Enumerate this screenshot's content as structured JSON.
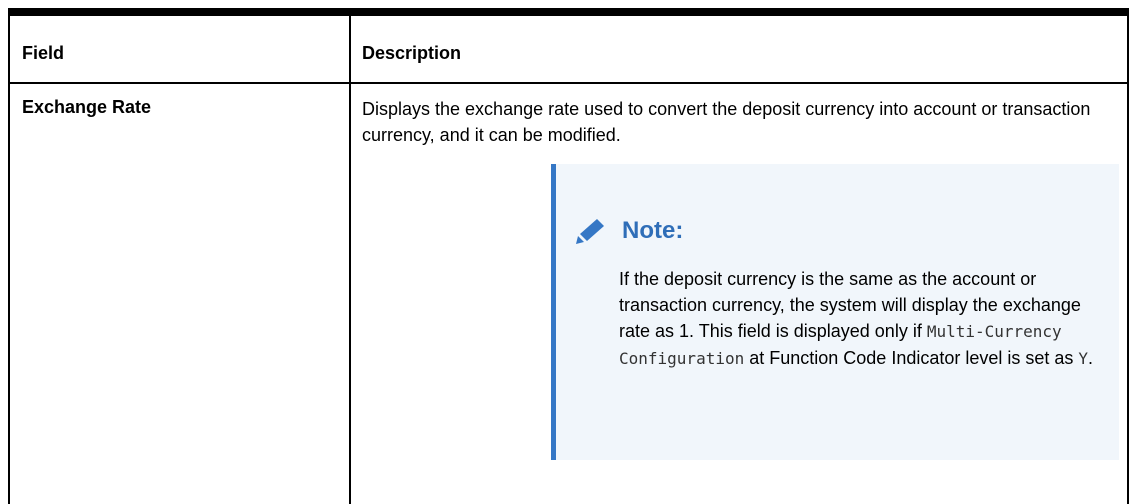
{
  "table": {
    "headers": {
      "field": "Field",
      "description": "Description"
    },
    "rows": [
      {
        "field": "Exchange Rate",
        "description": "Displays the exchange rate used to convert the deposit currency into account or transaction currency, and it can be modified.",
        "note": {
          "icon": "pencil-icon",
          "title": "Note:",
          "text_1": "If the deposit currency is the same as the account or transaction currency, the system will display the exchange rate as 1. This field is displayed only if ",
          "code_1": "Multi-Currency Configuration",
          "text_2": " at Function Code Indicator level is set as ",
          "code_2": "Y",
          "text_3": "."
        }
      }
    ]
  },
  "colors": {
    "border": "#000000",
    "note_accent": "#3577c5",
    "note_background": "#f1f6fb",
    "note_title": "#2f6eb8"
  }
}
